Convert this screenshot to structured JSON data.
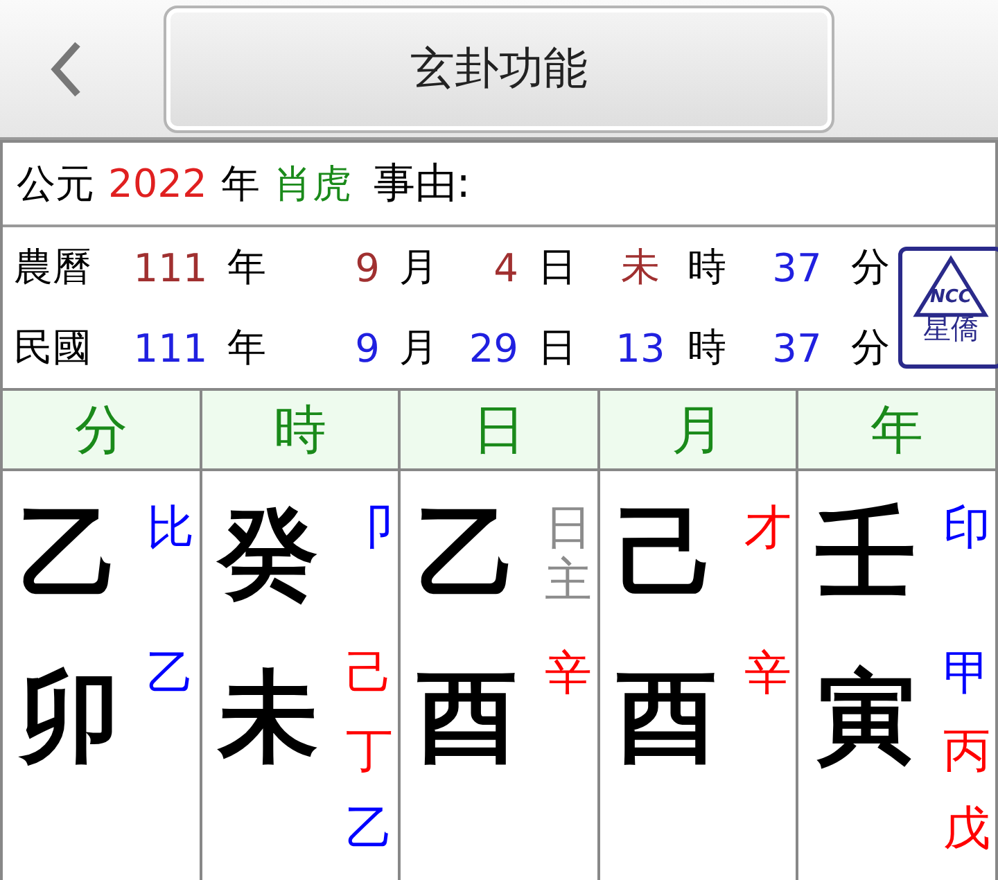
{
  "header": {
    "title": "玄卦功能"
  },
  "info": {
    "era_label": "公元",
    "year": "2022",
    "year_unit": "年",
    "zodiac": "肖虎",
    "reason_label": "事由:"
  },
  "dates": [
    {
      "label": "農曆",
      "fields": [
        {
          "value": "111",
          "color": "#a03030",
          "unit": "年"
        },
        {
          "value": "9",
          "color": "#a03030",
          "unit": "月"
        },
        {
          "value": "4",
          "color": "#a03030",
          "unit": "日"
        },
        {
          "value": "未",
          "color": "#a03030",
          "unit": "時"
        },
        {
          "value": "37",
          "color": "#2020e0",
          "unit": "分"
        }
      ]
    },
    {
      "label": "民國",
      "fields": [
        {
          "value": "111",
          "color": "#2020e0",
          "unit": "年"
        },
        {
          "value": "9",
          "color": "#2020e0",
          "unit": "月"
        },
        {
          "value": "29",
          "color": "#2020e0",
          "unit": "日"
        },
        {
          "value": "13",
          "color": "#2020e0",
          "unit": "時"
        },
        {
          "value": "37",
          "color": "#2020e0",
          "unit": "分"
        }
      ]
    }
  ],
  "logo": {
    "top": "NCC",
    "bottom": "星僑"
  },
  "pillars": [
    {
      "heading": "分",
      "stem": "乙",
      "ten_god": {
        "text": "比",
        "color": "#0000ff"
      },
      "branch": "卯",
      "hidden_stems": [
        {
          "text": "乙",
          "color": "#0000ff"
        }
      ]
    },
    {
      "heading": "時",
      "stem": "癸",
      "ten_god": {
        "text": "卩",
        "color": "#0000ff"
      },
      "branch": "未",
      "hidden_stems": [
        {
          "text": "己",
          "color": "#ff0000"
        },
        {
          "text": "丁",
          "color": "#ff0000"
        },
        {
          "text": "乙",
          "color": "#0000ff"
        }
      ]
    },
    {
      "heading": "日",
      "stem": "乙",
      "ten_god": {
        "text": "日主",
        "color": "#8c8c8c"
      },
      "branch": "酉",
      "hidden_stems": [
        {
          "text": "辛",
          "color": "#ff0000"
        }
      ]
    },
    {
      "heading": "月",
      "stem": "己",
      "ten_god": {
        "text": "才",
        "color": "#ff0000"
      },
      "branch": "酉",
      "hidden_stems": [
        {
          "text": "辛",
          "color": "#ff0000"
        }
      ]
    },
    {
      "heading": "年",
      "stem": "壬",
      "ten_god": {
        "text": "印",
        "color": "#0000ff"
      },
      "branch": "寅",
      "hidden_stems": [
        {
          "text": "甲",
          "color": "#0000ff"
        },
        {
          "text": "丙",
          "color": "#ff0000"
        },
        {
          "text": "戊",
          "color": "#ff0000"
        }
      ]
    }
  ]
}
